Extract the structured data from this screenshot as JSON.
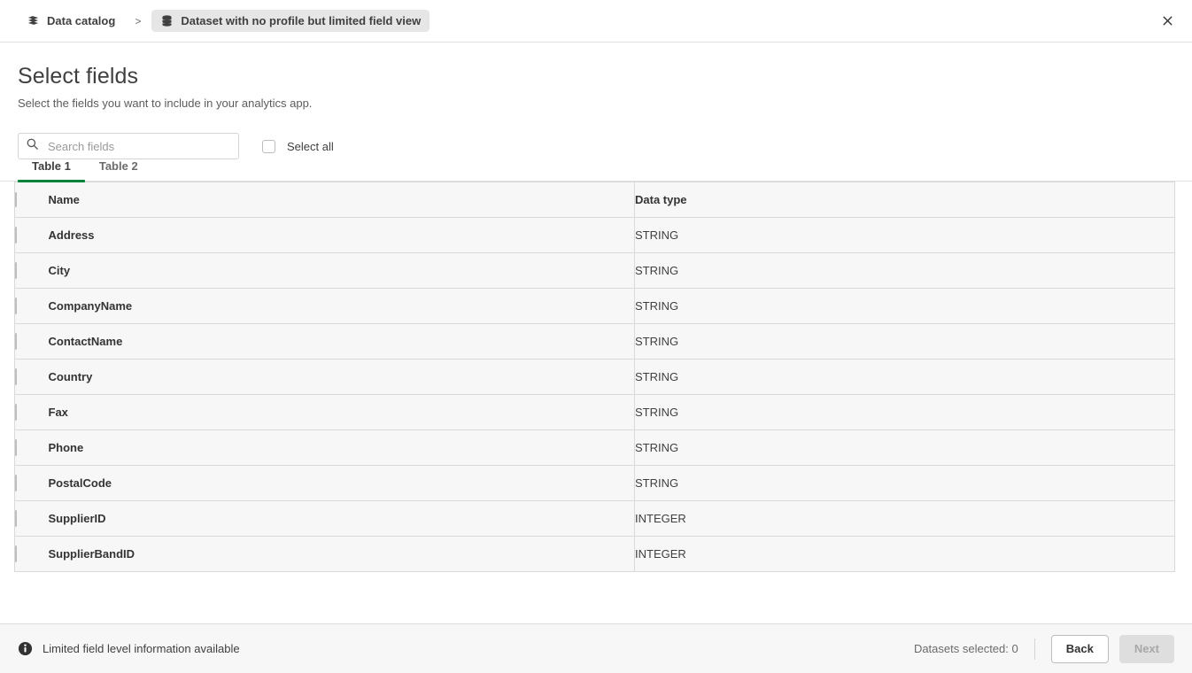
{
  "topbar": {
    "breadcrumbs": [
      {
        "label": "Data catalog",
        "icon": "data-catalog-icon",
        "active": false
      },
      {
        "label": "Dataset with no profile but limited field view",
        "icon": "dataset-icon",
        "active": true
      }
    ],
    "separator": ">",
    "close_label": "Close"
  },
  "header": {
    "title": "Select fields",
    "subtitle": "Select the fields you want to include in your analytics app."
  },
  "controls": {
    "search": {
      "value": "",
      "placeholder": "Search fields",
      "icon": "search-icon"
    },
    "select_all_label": "Select all"
  },
  "tabs": [
    {
      "label": "Table 1",
      "active": true
    },
    {
      "label": "Table 2",
      "active": false
    }
  ],
  "table": {
    "columns": [
      "Name",
      "Data type"
    ],
    "rows": [
      {
        "name": "Address",
        "type": "STRING"
      },
      {
        "name": "City",
        "type": "STRING"
      },
      {
        "name": "CompanyName",
        "type": "STRING"
      },
      {
        "name": "ContactName",
        "type": "STRING"
      },
      {
        "name": "Country",
        "type": "STRING"
      },
      {
        "name": "Fax",
        "type": "STRING"
      },
      {
        "name": "Phone",
        "type": "STRING"
      },
      {
        "name": "PostalCode",
        "type": "STRING"
      },
      {
        "name": "SupplierID",
        "type": "INTEGER"
      },
      {
        "name": "SupplierBandID",
        "type": "INTEGER"
      }
    ]
  },
  "footer": {
    "info_icon": "info-icon",
    "info_text": "Limited field level information available",
    "datasets_selected": "Datasets selected: 0",
    "back_label": "Back",
    "next_label": "Next"
  },
  "colors": {
    "accent_green": "#00823b",
    "row_bg": "#f7f7f7",
    "border": "#d9d9d9",
    "footer_bg": "#f7f7f7"
  }
}
